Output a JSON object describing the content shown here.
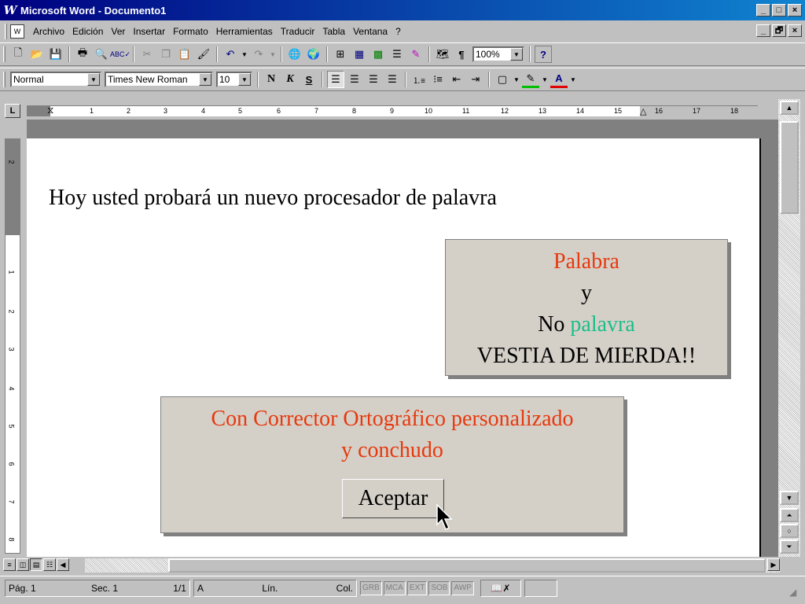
{
  "window": {
    "title": "Microsoft Word - Documento1",
    "logo_letter": "W",
    "caption_minimize": "_",
    "caption_maximize": "□",
    "caption_close": "×",
    "mdi_minimize": "_",
    "mdi_restore": "🗗",
    "mdi_close": "×"
  },
  "menu": {
    "items": [
      "Archivo",
      "Edición",
      "Ver",
      "Insertar",
      "Formato",
      "Herramientas",
      "Traducir",
      "Tabla",
      "Ventana",
      "?"
    ]
  },
  "toolbar": {
    "zoom": "100%",
    "style": "Normal",
    "font": "Times New Roman",
    "size": "10",
    "bold": "N",
    "italic": "K",
    "underline": "S",
    "icons": {
      "new": "new-document-icon",
      "open": "open-folder-icon",
      "save": "save-icon",
      "print": "print-icon",
      "preview": "print-preview-icon",
      "spell": "spelling-icon",
      "cut": "cut-icon",
      "copy": "copy-icon",
      "paste": "paste-icon",
      "format_painter": "format-painter-icon",
      "undo": "undo-icon",
      "redo": "redo-icon",
      "hyperlink": "hyperlink-icon",
      "web": "web-toolbar-icon",
      "tables_borders": "tables-borders-icon",
      "insert_table": "insert-table-icon",
      "insert_excel": "insert-excel-icon",
      "columns": "columns-icon",
      "drawing": "drawing-icon",
      "doc_map": "document-map-icon",
      "show_hide": "show-hide-icon",
      "help": "help-icon"
    }
  },
  "ruler": {
    "numbers": [
      "1",
      "2",
      "3",
      "4",
      "5",
      "6",
      "7",
      "8",
      "9",
      "10",
      "11",
      "12",
      "13",
      "14",
      "15",
      "16",
      "17",
      "18"
    ],
    "vertical_numbers": [
      "2",
      "1",
      "1",
      "2",
      "3",
      "4",
      "5",
      "6",
      "7",
      "8"
    ],
    "corner_label": "L"
  },
  "document": {
    "line1": "Hoy usted probará un nuevo procesador de palavra"
  },
  "box1": {
    "line1": "Palabra",
    "line2": "y",
    "line3_prefix": "No ",
    "line3_highlight": "palavra",
    "line4": "VESTIA DE MIERDA!!"
  },
  "box2": {
    "line1": "Con Corrector Ortográfico personalizado",
    "line2": "y conchudo",
    "button": "Aceptar"
  },
  "status": {
    "page": "Pág. 1",
    "section": "Sec. 1",
    "pages": "1/1",
    "at": "A",
    "line": "Lín.",
    "col": "Col.",
    "flags": [
      "GRB",
      "MCA",
      "EXT",
      "SOB",
      "AWP"
    ]
  },
  "colors": {
    "title_bar": "#000080",
    "red_text": "#e8380d",
    "green_text": "#1cbe8a"
  }
}
